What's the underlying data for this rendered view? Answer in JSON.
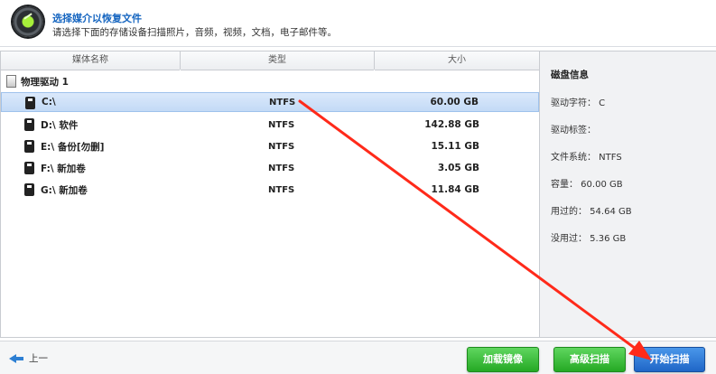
{
  "header": {
    "title": "选择媒介以恢复文件",
    "subtitle": "请选择下面的存储设备扫描照片，音频，视频，文档，电子邮件等。"
  },
  "table": {
    "columns": [
      "媒体名称",
      "类型",
      "大小"
    ],
    "group_label": "物理驱动 1",
    "drives": [
      {
        "name": "C:\\",
        "type": "NTFS",
        "size": "60.00 GB",
        "selected": true
      },
      {
        "name": "D:\\ 软件",
        "type": "NTFS",
        "size": "142.88 GB",
        "selected": false
      },
      {
        "name": "E:\\ 备份[勿删]",
        "type": "NTFS",
        "size": "15.11 GB",
        "selected": false
      },
      {
        "name": "F:\\ 新加卷",
        "type": "NTFS",
        "size": "3.05 GB",
        "selected": false
      },
      {
        "name": "G:\\ 新加卷",
        "type": "NTFS",
        "size": "11.84 GB",
        "selected": false
      }
    ]
  },
  "info": {
    "title": "磁盘信息",
    "lines": [
      "驱动字符： C",
      "驱动标签：",
      "文件系统： NTFS",
      "容量： 60.00 GB",
      "用过的： 54.64 GB",
      "没用过： 5.36 GB"
    ]
  },
  "footer": {
    "back_label": "上一",
    "load_image_label": "加载镜像",
    "advanced_scan_label": "高级扫描",
    "start_scan_label": "开始扫描"
  },
  "colors": {
    "accent": "#1f66c7",
    "green": "#25a924",
    "annotation_red": "#ff2a1a"
  }
}
